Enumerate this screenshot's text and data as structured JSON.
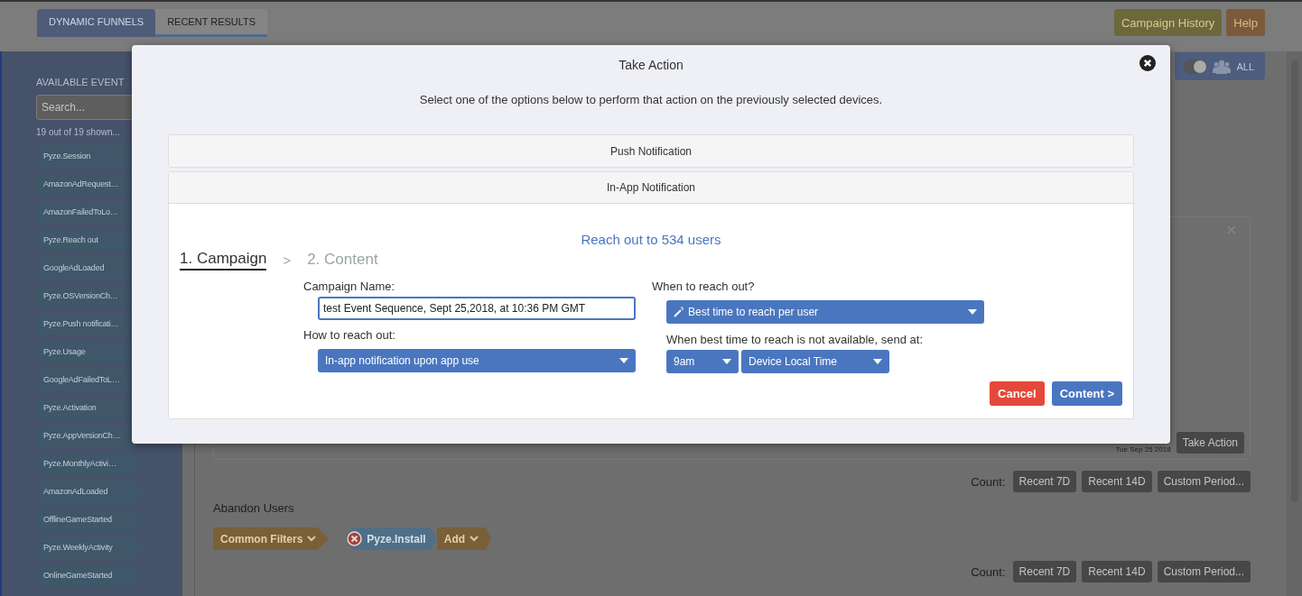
{
  "tabs": [
    {
      "label": "DYNAMIC FUNNELS",
      "selected": true
    },
    {
      "label": "RECENT RESULTS",
      "selected": false
    }
  ],
  "header_buttons": [
    {
      "label": "Campaign History",
      "kind": "history"
    },
    {
      "label": "Help",
      "kind": "help"
    }
  ],
  "sidebar": {
    "title": "AVAILABLE EVENT",
    "search_placeholder": "Search...",
    "count": "19 out of 19 shown...",
    "events": [
      "Pyze.Session",
      "AmazonAdRequest…",
      "AmazonFailedToLo…",
      "Pyze.Reach out",
      "GoogleAdLoaded",
      "Pyze.OSVersionCh…",
      "Pyze.Push notificati…",
      "Pyze.Usage",
      "GoogleAdFailedToL…",
      "Pyze.Activation",
      "Pyze.AppVersionCh…",
      "Pyze.MonthlyActivi…",
      "AmazonAdLoaded",
      "OfflineGameStarted",
      "Pyze.WeeklyActivity",
      "OnlineGameStarted"
    ]
  },
  "audience_toggle": {
    "on": true,
    "label": "ALL"
  },
  "result_card": {
    "date": "Tue Sep 25 2018",
    "action": "Take Action"
  },
  "count_rows": [
    {
      "label": "Count:",
      "buttons": [
        "Recent 7D",
        "Recent 14D",
        "Custom Period..."
      ]
    },
    {
      "label": "Count:",
      "buttons": [
        "Recent 7D",
        "Recent 14D",
        "Custom Period..."
      ]
    }
  ],
  "section": {
    "title": "Abandon Users",
    "chips": [
      {
        "label": "Common Filters",
        "kind": "filter"
      },
      {
        "label": "Pyze.Install",
        "kind": "event"
      },
      {
        "label": "Add",
        "kind": "filter"
      }
    ]
  },
  "modal": {
    "title": "Take Action",
    "subtitle": "Select one of the options below to perform that action on the previously selected devices.",
    "panels": [
      {
        "title": "Push Notification",
        "expanded": false
      },
      {
        "title": "In-App Notification",
        "expanded": true
      }
    ],
    "reach": "Reach out to 534 users",
    "steps": [
      {
        "label": "1. Campaign",
        "selected": true
      },
      {
        "label": "2. Content",
        "selected": false
      }
    ],
    "step_separator": ">",
    "campaign_name": {
      "label": "Campaign Name:",
      "value": "test Event Sequence, Sept 25,2018, at 10:36 PM GMT"
    },
    "how": {
      "label": "How to reach out:",
      "value": "In-app notification upon app use"
    },
    "when": {
      "label": "When to reach out?",
      "value": "Best time to reach per user"
    },
    "fallback": {
      "label": "When best time to reach is not available, send at:",
      "time": "9am",
      "zone": "Device Local Time"
    },
    "buttons": [
      {
        "label": "Cancel",
        "kind": "cancel"
      },
      {
        "label": "Content >",
        "kind": "next"
      }
    ]
  }
}
